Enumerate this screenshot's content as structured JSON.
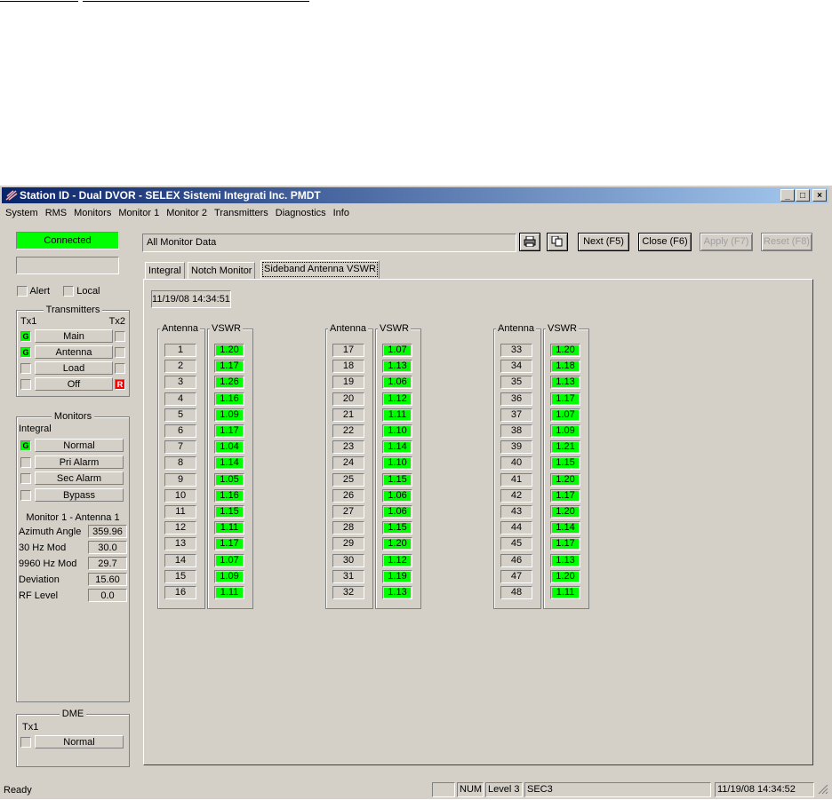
{
  "window": {
    "title": "Station ID - Dual DVOR - SELEX Sistemi Integrati Inc. PMDT"
  },
  "menu": [
    "System",
    "RMS",
    "Monitors",
    "Monitor 1",
    "Monitor 2",
    "Transmitters",
    "Diagnostics",
    "Info"
  ],
  "left": {
    "connected": "Connected",
    "alert": "Alert",
    "local": "Local",
    "transmitters": {
      "caption": "Transmitters",
      "tx1": "Tx1",
      "tx2": "Tx2",
      "rows": [
        {
          "label": "Main",
          "left": "G",
          "right": ""
        },
        {
          "label": "Antenna",
          "left": "G",
          "right": ""
        },
        {
          "label": "Load",
          "left": "",
          "right": ""
        },
        {
          "label": "Off",
          "left": "",
          "right": "R"
        }
      ]
    },
    "monitors": {
      "caption": "Monitors",
      "sub": "Integral",
      "rows": [
        {
          "label": "Normal",
          "state": "G"
        },
        {
          "label": "Pri Alarm",
          "state": ""
        },
        {
          "label": "Sec Alarm",
          "state": ""
        },
        {
          "label": "Bypass",
          "state": ""
        }
      ],
      "monitor_title": "Monitor 1 - Antenna 1",
      "readings": [
        {
          "label": "Azimuth Angle",
          "value": "359.96"
        },
        {
          "label": "30 Hz Mod",
          "value": "30.0"
        },
        {
          "label": "9960 Hz Mod",
          "value": "29.7"
        },
        {
          "label": "Deviation",
          "value": "15.60"
        },
        {
          "label": "RF Level",
          "value": "0.0"
        }
      ]
    },
    "dme": {
      "caption": "DME",
      "tx1": "Tx1",
      "row": "Normal"
    }
  },
  "main": {
    "title": "All Monitor Data",
    "buttons": {
      "next": "Next (F5)",
      "close": "Close (F6)",
      "apply": "Apply (F7)",
      "reset": "Reset (F8)"
    },
    "tabs": [
      "Integral",
      "Notch Monitor",
      "Sideband Antenna VSWR"
    ],
    "timestamp": "11/19/08 14:34:51",
    "antenna_header": "Antenna",
    "vswr_header": "VSWR",
    "vswr": [
      [
        "1",
        "1.20"
      ],
      [
        "2",
        "1.17"
      ],
      [
        "3",
        "1.26"
      ],
      [
        "4",
        "1.16"
      ],
      [
        "5",
        "1.09"
      ],
      [
        "6",
        "1.17"
      ],
      [
        "7",
        "1.04"
      ],
      [
        "8",
        "1.14"
      ],
      [
        "9",
        "1.05"
      ],
      [
        "10",
        "1.16"
      ],
      [
        "11",
        "1.15"
      ],
      [
        "12",
        "1.11"
      ],
      [
        "13",
        "1.17"
      ],
      [
        "14",
        "1.07"
      ],
      [
        "15",
        "1.09"
      ],
      [
        "16",
        "1.11"
      ],
      [
        "17",
        "1.07"
      ],
      [
        "18",
        "1.13"
      ],
      [
        "19",
        "1.06"
      ],
      [
        "20",
        "1.12"
      ],
      [
        "21",
        "1.11"
      ],
      [
        "22",
        "1.10"
      ],
      [
        "23",
        "1.14"
      ],
      [
        "24",
        "1.10"
      ],
      [
        "25",
        "1.15"
      ],
      [
        "26",
        "1.06"
      ],
      [
        "27",
        "1.06"
      ],
      [
        "28",
        "1.15"
      ],
      [
        "29",
        "1.20"
      ],
      [
        "30",
        "1.12"
      ],
      [
        "31",
        "1.19"
      ],
      [
        "32",
        "1.13"
      ],
      [
        "33",
        "1.20"
      ],
      [
        "34",
        "1.18"
      ],
      [
        "35",
        "1.13"
      ],
      [
        "36",
        "1.17"
      ],
      [
        "37",
        "1.07"
      ],
      [
        "38",
        "1.09"
      ],
      [
        "39",
        "1.21"
      ],
      [
        "40",
        "1.15"
      ],
      [
        "41",
        "1.20"
      ],
      [
        "42",
        "1.17"
      ],
      [
        "43",
        "1.20"
      ],
      [
        "44",
        "1.14"
      ],
      [
        "45",
        "1.17"
      ],
      [
        "46",
        "1.13"
      ],
      [
        "47",
        "1.20"
      ],
      [
        "48",
        "1.11"
      ]
    ]
  },
  "status": {
    "ready": "Ready",
    "num": "NUM",
    "level": "Level 3",
    "sec": "SEC3",
    "datetime": "11/19/08 14:34:52"
  },
  "colors": {
    "green": "#00ff00",
    "red": "#ff0000",
    "face": "#d4d0c8",
    "title_start": "#0a246a",
    "title_end": "#a6caf0"
  }
}
